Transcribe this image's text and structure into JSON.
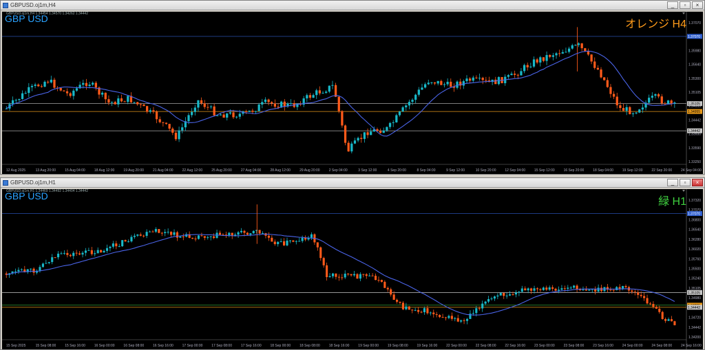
{
  "top": {
    "title": "GBPUSD.oj1m,H4",
    "symbol": "GBP USD",
    "ohlc": "GBPUSD.oj1m,H4  1.34454 1.34570 1.34262 1.34442",
    "tag": "オレンジ H4",
    "tag_color": "#ff9b1a",
    "y_labels": [
      "1.37070",
      "1.36670",
      "1.35980",
      "1.35640",
      "1.35300",
      "1.35105",
      "1.34955",
      "1.34442",
      "1.33930",
      "1.33590",
      "1.33250"
    ],
    "x_labels": [
      "12 Aug 2025",
      "13 Aug 20:00",
      "15 Aug 04:00",
      "18 Aug 12:00",
      "19 Aug 20:00",
      "21 Aug 04:00",
      "22 Aug 12:00",
      "25 Aug 20:00",
      "27 Aug 04:00",
      "28 Aug 12:00",
      "29 Aug 20:00",
      "2 Sep 04:00",
      "3 Sep 12:00",
      "4 Sep 20:00",
      "8 Sep 04:00",
      "9 Sep 12:00",
      "10 Sep 20:00",
      "12 Sep 04:00",
      "15 Sep 12:00",
      "16 Sep 20:00",
      "18 Sep 04:00",
      "19 Sep 12:00",
      "22 Sep 20:00",
      "24 Sep 04:00"
    ],
    "price_boxes": [
      {
        "label": "1.37070",
        "color": "#2f5fd0"
      },
      {
        "label": "1.35105",
        "color": "#c8c8c8"
      },
      {
        "label": "1.34955",
        "color": "#e89a1a"
      },
      {
        "label": "1.34442",
        "color": "#c8c8c8"
      }
    ]
  },
  "bottom": {
    "title": "GBPUSD.oj1m,H1",
    "symbol": "GBP USD",
    "ohlc": "GBPUSD.oj1m,H1  1.34469 1.34492 1.34404 1.34442",
    "tag": "緑 H1",
    "tag_color": "#3fcf3f",
    "y_labels": [
      "1.37320",
      "1.37070",
      "1.36800",
      "1.36540",
      "1.36280",
      "1.36020",
      "1.35760",
      "1.35500",
      "1.35240",
      "1.35105",
      "1.34980",
      "1.34955",
      "1.34720",
      "1.34442",
      "1.34200"
    ],
    "x_labels": [
      "15 Sep 2025",
      "15 Sep 08:00",
      "15 Sep 16:00",
      "16 Sep 00:00",
      "16 Sep 08:00",
      "16 Sep 16:00",
      "17 Sep 00:00",
      "17 Sep 08:00",
      "17 Sep 16:00",
      "18 Sep 00:00",
      "18 Sep 08:00",
      "18 Sep 16:00",
      "19 Sep 00:00",
      "19 Sep 08:00",
      "19 Sep 16:00",
      "22 Sep 00:00",
      "22 Sep 08:00",
      "22 Sep 16:00",
      "23 Sep 00:00",
      "23 Sep 08:00",
      "23 Sep 16:00",
      "24 Sep 00:00",
      "24 Sep 08:00",
      "24 Sep 16:00"
    ],
    "price_boxes": [
      {
        "label": "1.37070",
        "color": "#2f5fd0"
      },
      {
        "label": "1.35105",
        "color": "#c8c8c8"
      },
      {
        "label": "1.34955",
        "color": "#e89a1a"
      },
      {
        "label": "1.34442",
        "color": "#c8c8c8"
      }
    ]
  },
  "buttons": {
    "minimize": "_",
    "restore": "▫",
    "close": "×"
  }
}
